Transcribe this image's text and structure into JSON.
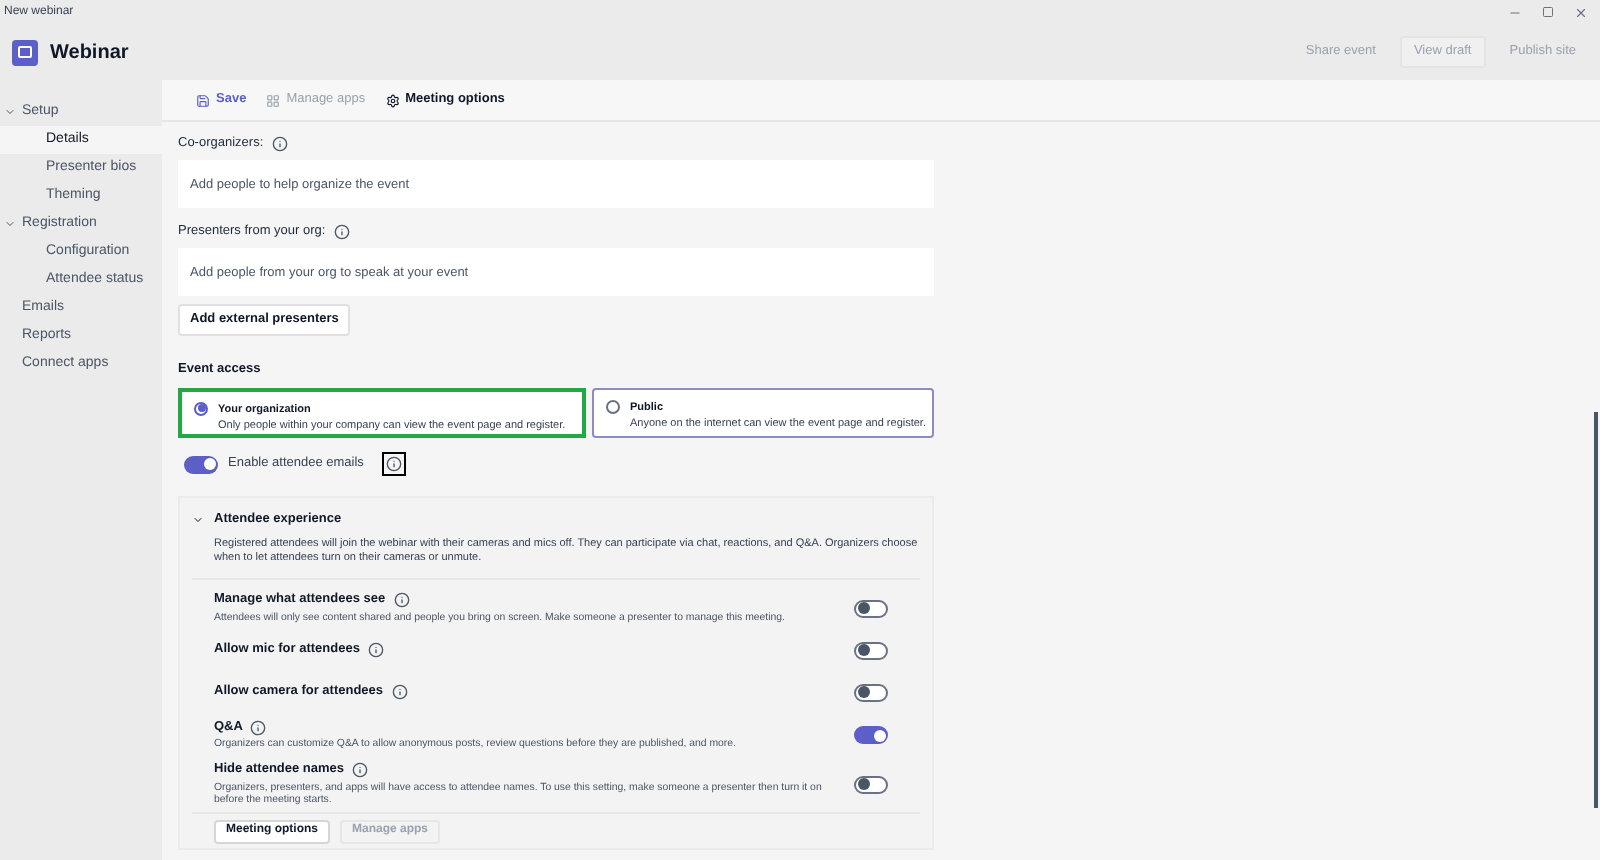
{
  "window": {
    "title": "New webinar"
  },
  "header": {
    "app_name": "Webinar",
    "actions": [
      {
        "label": "Share event",
        "disabled": true
      },
      {
        "label": "View draft",
        "disabled": true
      },
      {
        "label": "Publish site",
        "disabled": true
      }
    ]
  },
  "sidebar": {
    "items": [
      {
        "label": "Setup",
        "expanded": true,
        "selected": false,
        "children": [
          {
            "label": "Details",
            "selected": true
          },
          {
            "label": "Presenter bios",
            "selected": false
          },
          {
            "label": "Theming",
            "selected": false
          }
        ]
      },
      {
        "label": "Registration",
        "expanded": true,
        "selected": false,
        "children": [
          {
            "label": "Configuration",
            "selected": false
          },
          {
            "label": "Attendee status",
            "selected": false
          }
        ]
      },
      {
        "label": "Emails",
        "selected": false
      },
      {
        "label": "Reports",
        "selected": false
      },
      {
        "label": "Connect apps",
        "selected": false
      }
    ]
  },
  "toolbar": [
    {
      "kind": "save",
      "label": "Save",
      "disabled": false
    },
    {
      "kind": "apps",
      "label": "Manage apps",
      "disabled": true
    },
    {
      "kind": "options",
      "label": "Meeting options",
      "disabled": false
    }
  ],
  "co_organizers": {
    "label": "Co-organizers:",
    "placeholder": "Add people to help organize the event"
  },
  "presenters": {
    "label": "Presenters from your org:",
    "placeholder": "Add people from your org to speak at your event"
  },
  "add_external_button": "Add external presenters",
  "event_access": {
    "title": "Event access",
    "options": [
      {
        "title": "Your organization",
        "description": "Only people within your company can view the event page and register.",
        "selected": true
      },
      {
        "title": "Public",
        "description": "Anyone on the internet can view the event page and register.",
        "selected": false
      }
    ]
  },
  "attendee_emails": {
    "label": "Enable attendee emails",
    "on": true
  },
  "attendee_experience": {
    "title": "Attendee experience",
    "expanded": true,
    "description": "Registered attendees will join the webinar with their cameras and mics off. They can participate via chat, reactions, and Q&A. Organizers choose when to let attendees turn on their cameras or unmute.",
    "settings": [
      {
        "title": "Manage what attendees see",
        "description": "Attendees will only see content shared and people you bring on screen. Make someone a presenter to manage this meeting.",
        "on": false
      },
      {
        "title": "Allow mic for attendees",
        "on": false
      },
      {
        "title": "Allow camera for attendees",
        "on": false
      },
      {
        "title": "Q&A",
        "description": "Organizers can customize Q&A to allow anonymous posts, review questions before they are published, and more.",
        "on": true
      },
      {
        "title": "Hide attendee names",
        "description": "Organizers, presenters, and apps will have access to attendee names. To use this setting, make someone a presenter then turn it on before the meeting starts.",
        "on": false
      }
    ],
    "buttons": [
      {
        "label": "Meeting options",
        "disabled": false
      },
      {
        "label": "Manage apps",
        "disabled": true
      }
    ]
  }
}
